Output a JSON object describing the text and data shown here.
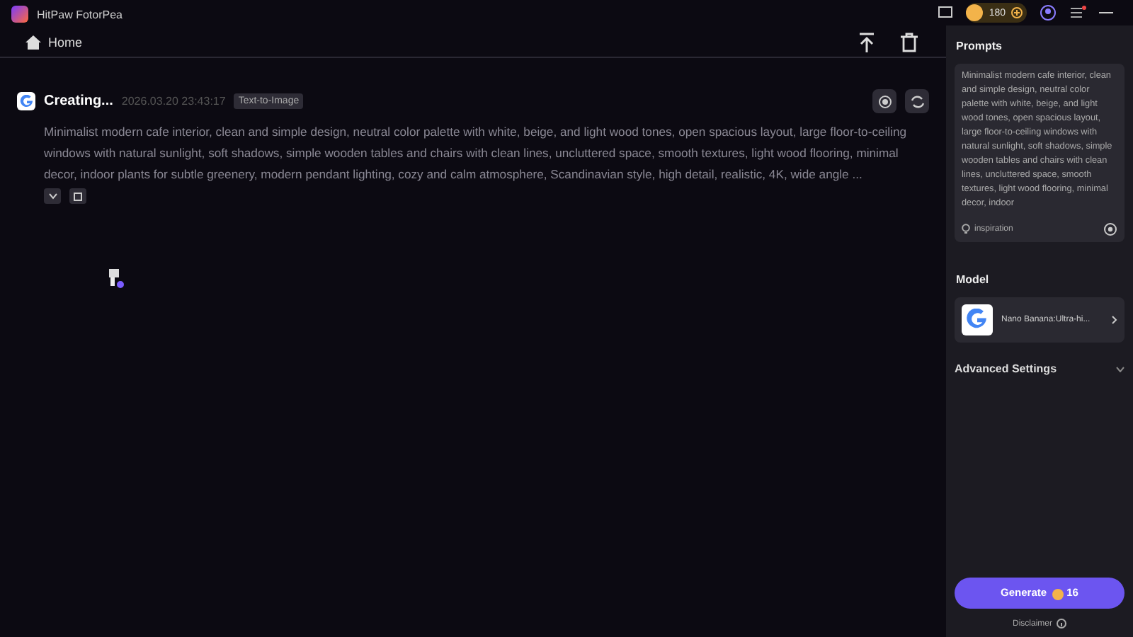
{
  "app": {
    "title": "HitPaw FotorPea",
    "credits": "180"
  },
  "nav": {
    "home": "Home"
  },
  "task": {
    "status": "Creating...",
    "timestamp": "2026.03.20  23:43:17",
    "tag": "Text-to-Image",
    "prompt": "Minimalist modern cafe interior, clean and simple design, neutral color palette with white, beige, and light wood tones, open spacious layout, large floor-to-ceiling windows with natural sunlight, soft shadows, simple wooden tables and chairs with clean lines, uncluttered space, smooth textures, light wood flooring, minimal decor, indoor plants for subtle greenery, modern pendant lighting, cozy and calm atmosphere, Scandinavian style, high detail, realistic, 4K, wide angle ..."
  },
  "sidebar": {
    "prompts_title": "Prompts",
    "prompt": "Minimalist modern cafe interior, clean and simple design, neutral color palette with white, beige, and light wood tones, open spacious layout, large floor-to-ceiling windows with natural sunlight, soft shadows, simple wooden tables and chairs with clean lines, uncluttered space, smooth textures, light wood flooring, minimal decor, indoor",
    "inspiration": "inspiration",
    "model_title": "Model",
    "model": "Nano Banana:Ultra-hi...",
    "advanced": "Advanced Settings",
    "generate": "Generate",
    "cost": "16",
    "disclaimer": "Disclaimer"
  }
}
